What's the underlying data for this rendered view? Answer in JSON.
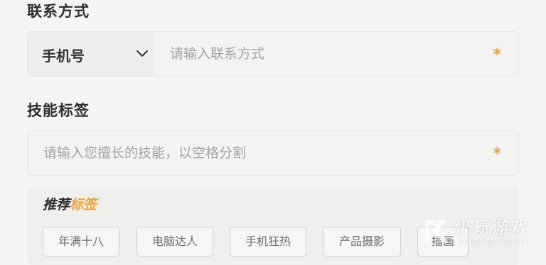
{
  "contact": {
    "title": "联系方式",
    "type_select": "手机号",
    "input_placeholder": "请输入联系方式",
    "required_mark": "*"
  },
  "skills": {
    "title": "技能标签",
    "input_placeholder": "请输入您擅长的技能，以空格分割",
    "required_mark": "*"
  },
  "recommended": {
    "title_part1": "推荐",
    "title_part2": "标签",
    "tags": [
      "年满十八",
      "电脑达人",
      "手机狂热",
      "产品摄影",
      "插画"
    ]
  },
  "watermark": {
    "name": "仍玩游戏",
    "sub": "Rengwan Games"
  },
  "colors": {
    "accent": "#efa230",
    "required": "#e5a23c",
    "title_text": "#2e2e2e",
    "placeholder": "#a2a4a4",
    "tag_border": "#cfcfcd",
    "background": "#f5f6f4"
  },
  "icons": {
    "dropdown": "chevron-down-icon"
  }
}
